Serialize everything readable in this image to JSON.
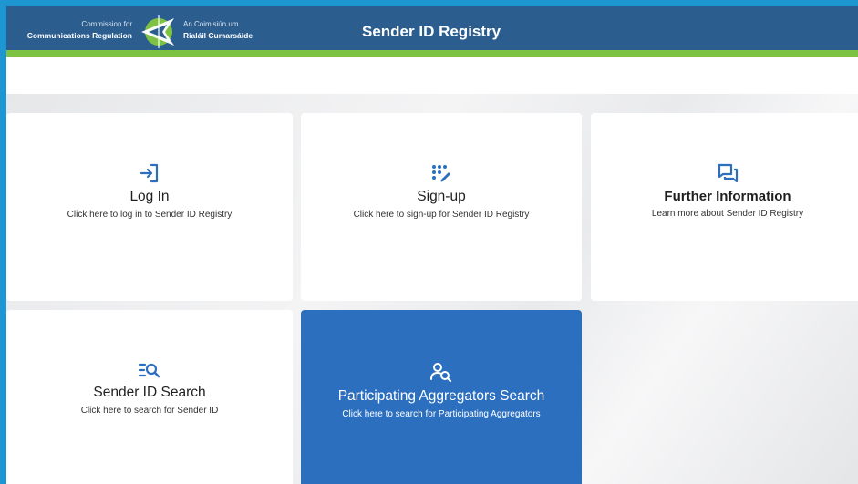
{
  "header": {
    "logo_en_small": "Commission for",
    "logo_en_big": "Communications Regulation",
    "logo_ga_small": "An Coimisiún um",
    "logo_ga_big": "Rialáil Cumarsáide",
    "app_title": "Sender ID Registry"
  },
  "tiles": [
    {
      "icon": "login-icon",
      "title": "Log In",
      "desc": "Click here to log in to Sender ID Registry"
    },
    {
      "icon": "signup-icon",
      "title": "Sign-up",
      "desc": "Click here to sign-up for Sender ID Registry"
    },
    {
      "icon": "chat-icon",
      "title": "Further Information",
      "desc": "Learn more about Sender ID Registry"
    },
    {
      "icon": "search-list-icon",
      "title": "Sender ID Search",
      "desc": "Click here to search for Sender ID"
    },
    {
      "icon": "user-search-icon",
      "title": "Participating Aggregators Search",
      "desc": "Click here to search for Participating Aggregators"
    }
  ],
  "colors": {
    "frame": "#1e96d2",
    "header": "#2b5d8f",
    "header_stripe": "#7dc242",
    "icon_blue": "#2c6fbf",
    "active_tile": "#2c6fbf"
  }
}
